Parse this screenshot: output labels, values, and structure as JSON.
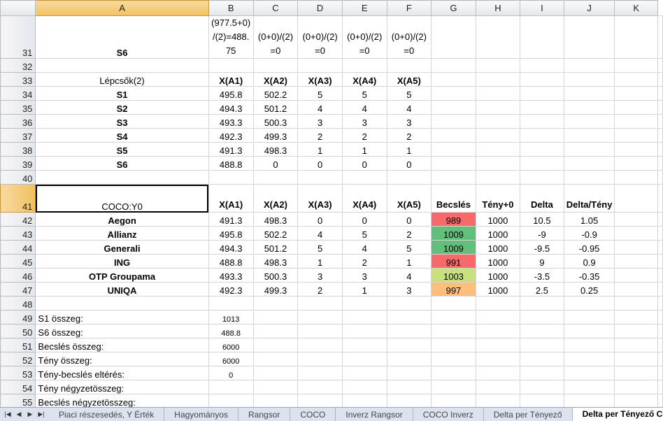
{
  "columns": [
    "A",
    "B",
    "C",
    "D",
    "E",
    "F",
    "G",
    "H",
    "I",
    "J",
    "K"
  ],
  "selected_column": "A",
  "selected_row": "41",
  "rows": [
    {
      "n": "31",
      "h": 60,
      "a": "S6",
      "a_bold": true,
      "a_center": true,
      "vals": [
        "(977.5+0) /(2)=488. 75",
        "(0+0)/(2) =0",
        "(0+0)/(2) =0",
        "(0+0)/(2) =0",
        "(0+0)/(2) =0",
        "",
        "",
        "",
        "",
        ""
      ],
      "wrap": true
    },
    {
      "n": "32",
      "a": "",
      "vals": [
        "",
        "",
        "",
        "",
        "",
        "",
        "",
        "",
        "",
        ""
      ]
    },
    {
      "n": "33",
      "a": "Lépcsők(2)",
      "a_center": true,
      "vals": [
        "X(A1)",
        "X(A2)",
        "X(A3)",
        "X(A4)",
        "X(A5)",
        "",
        "",
        "",
        "",
        ""
      ],
      "bold_vals": true
    },
    {
      "n": "34",
      "a": "S1",
      "a_bold": true,
      "a_center": true,
      "vals": [
        "495.8",
        "502.2",
        "5",
        "5",
        "5",
        "",
        "",
        "",
        "",
        ""
      ]
    },
    {
      "n": "35",
      "a": "S2",
      "a_bold": true,
      "a_center": true,
      "vals": [
        "494.3",
        "501.2",
        "4",
        "4",
        "4",
        "",
        "",
        "",
        "",
        ""
      ]
    },
    {
      "n": "36",
      "a": "S3",
      "a_bold": true,
      "a_center": true,
      "vals": [
        "493.3",
        "500.3",
        "3",
        "3",
        "3",
        "",
        "",
        "",
        "",
        ""
      ]
    },
    {
      "n": "37",
      "a": "S4",
      "a_bold": true,
      "a_center": true,
      "vals": [
        "492.3",
        "499.3",
        "2",
        "2",
        "2",
        "",
        "",
        "",
        "",
        ""
      ]
    },
    {
      "n": "38",
      "a": "S5",
      "a_bold": true,
      "a_center": true,
      "vals": [
        "491.3",
        "498.3",
        "1",
        "1",
        "1",
        "",
        "",
        "",
        "",
        ""
      ]
    },
    {
      "n": "39",
      "a": "S6",
      "a_bold": true,
      "a_center": true,
      "vals": [
        "488.8",
        "0",
        "0",
        "0",
        "0",
        "",
        "",
        "",
        "",
        ""
      ]
    },
    {
      "n": "40",
      "a": "",
      "vals": [
        "",
        "",
        "",
        "",
        "",
        "",
        "",
        "",
        "",
        ""
      ]
    },
    {
      "n": "41",
      "h": 40,
      "a": "COCO:Y0",
      "a_center": true,
      "a_active": true,
      "vals": [
        "X(A1)",
        "X(A2)",
        "X(A3)",
        "X(A4)",
        "X(A5)",
        "Becslés",
        "Tény+0",
        "Delta",
        "Delta/Tény",
        ""
      ],
      "bold_vals": true,
      "wrap": true
    },
    {
      "n": "42",
      "a": "Aegon",
      "a_bold": true,
      "a_center": true,
      "vals": [
        "491.3",
        "498.3",
        "0",
        "0",
        "0",
        "989",
        "1000",
        "10.5",
        "1.05",
        ""
      ],
      "g_color": "#f8696b"
    },
    {
      "n": "43",
      "a": "Allianz",
      "a_bold": true,
      "a_center": true,
      "vals": [
        "495.8",
        "502.2",
        "4",
        "5",
        "2",
        "1009",
        "1000",
        "-9",
        "-0.9",
        ""
      ],
      "g_color": "#63be7b"
    },
    {
      "n": "44",
      "a": "Generali",
      "a_bold": true,
      "a_center": true,
      "vals": [
        "494.3",
        "501.2",
        "5",
        "4",
        "5",
        "1009",
        "1000",
        "-9.5",
        "-0.95",
        ""
      ],
      "g_color": "#63be7b"
    },
    {
      "n": "45",
      "a": "ING",
      "a_bold": true,
      "a_center": true,
      "vals": [
        "488.8",
        "498.3",
        "1",
        "2",
        "1",
        "991",
        "1000",
        "9",
        "0.9",
        ""
      ],
      "g_color": "#f8696b"
    },
    {
      "n": "46",
      "a": "OTP Groupama",
      "a_bold": true,
      "a_center": true,
      "vals": [
        "493.3",
        "500.3",
        "3",
        "3",
        "4",
        "1003",
        "1000",
        "-3.5",
        "-0.35",
        ""
      ],
      "g_color": "#c9e07f"
    },
    {
      "n": "47",
      "a": "UNIQA",
      "a_bold": true,
      "a_center": true,
      "vals": [
        "492.3",
        "499.3",
        "2",
        "1",
        "3",
        "997",
        "1000",
        "2.5",
        "0.25",
        ""
      ],
      "g_color": "#fdbf7b"
    },
    {
      "n": "48",
      "a": "",
      "vals": [
        "",
        "",
        "",
        "",
        "",
        "",
        "",
        "",
        "",
        ""
      ]
    },
    {
      "n": "49",
      "a": "S1 összeg:",
      "vals": [
        "1013",
        "",
        "",
        "",
        "",
        "",
        "",
        "",
        "",
        ""
      ],
      "small_b": true
    },
    {
      "n": "50",
      "a": "S6 összeg:",
      "vals": [
        "488.8",
        "",
        "",
        "",
        "",
        "",
        "",
        "",
        "",
        ""
      ],
      "small_b": true
    },
    {
      "n": "51",
      "a": "Becslés összeg:",
      "vals": [
        "6000",
        "",
        "",
        "",
        "",
        "",
        "",
        "",
        "",
        ""
      ],
      "small_b": true
    },
    {
      "n": "52",
      "a": "Tény összeg:",
      "vals": [
        "6000",
        "",
        "",
        "",
        "",
        "",
        "",
        "",
        "",
        ""
      ],
      "small_b": true
    },
    {
      "n": "53",
      "a": "Tény-becslés eltérés:",
      "vals": [
        "0",
        "",
        "",
        "",
        "",
        "",
        "",
        "",
        "",
        ""
      ],
      "small_b": true
    },
    {
      "n": "54",
      "a": "Tény négyzetösszeg:",
      "vals": [
        "",
        "",
        "",
        "",
        "",
        "",
        "",
        "",
        "",
        ""
      ]
    },
    {
      "n": "55",
      "a": "Becslés négyzetösszeg:",
      "vals": [
        "",
        "",
        "",
        "",
        "",
        "",
        "",
        "",
        "",
        ""
      ]
    }
  ],
  "sheet_tabs": [
    {
      "label": "Piaci részesedés, Y Érték",
      "active": false
    },
    {
      "label": "Hagyományos",
      "active": false
    },
    {
      "label": "Rangsor",
      "active": false
    },
    {
      "label": "COCO",
      "active": false
    },
    {
      "label": "Inverz Rangsor",
      "active": false
    },
    {
      "label": "COCO Inverz",
      "active": false
    },
    {
      "label": "Delta per Tényező",
      "active": false
    },
    {
      "label": "Delta per Tényező CO",
      "active": true
    }
  ],
  "nav_icons": [
    "first-sheet-icon",
    "prev-sheet-icon",
    "next-sheet-icon",
    "last-sheet-icon"
  ]
}
